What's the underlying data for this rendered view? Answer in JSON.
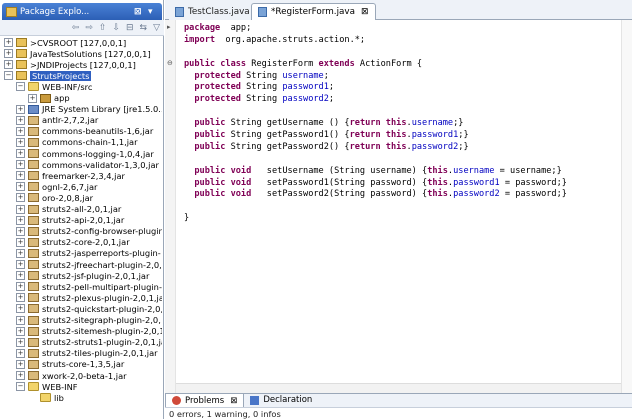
{
  "explorer": {
    "title": "Package Explo...",
    "close": "⊠",
    "menu": "▾",
    "toolbar": [
      "⇦",
      "⇨",
      "⇧",
      "⇩",
      "⊟",
      "⇆",
      "▽"
    ],
    "items": [
      {
        "label": ">CVSROOT   [127,0,0,1]",
        "icon": "project-icon",
        "expander": "+",
        "indent": 0
      },
      {
        "label": "JavaTestSolutions   [127,0,0,1]",
        "icon": "project-icon",
        "expander": "+",
        "indent": 0
      },
      {
        "label": ">JNDIProjects   [127,0,0,1]",
        "icon": "project-icon",
        "expander": "+",
        "indent": 0
      },
      {
        "label": "StrutsProjects",
        "icon": "project-icon",
        "expander": "−",
        "indent": 0,
        "selected": true
      },
      {
        "label": "WEB-INF/src",
        "icon": "source-folder-icon",
        "expander": "−",
        "indent": 1
      },
      {
        "label": "app",
        "icon": "package-icon",
        "expander": "+",
        "indent": 2
      },
      {
        "label": "JRE System Library [jre1.5.0...",
        "icon": "library-icon",
        "expander": "+",
        "indent": 1
      },
      {
        "label": "antlr-2,7,2,jar",
        "icon": "jar-icon",
        "expander": "+",
        "indent": 1
      },
      {
        "label": "commons-beanutils-1,6,jar",
        "icon": "jar-icon",
        "expander": "+",
        "indent": 1
      },
      {
        "label": "commons-chain-1,1,jar",
        "icon": "jar-icon",
        "expander": "+",
        "indent": 1
      },
      {
        "label": "commons-logging-1,0,4,jar",
        "icon": "jar-icon",
        "expander": "+",
        "indent": 1
      },
      {
        "label": "commons-validator-1,3,0,jar",
        "icon": "jar-icon",
        "expander": "+",
        "indent": 1
      },
      {
        "label": "freemarker-2,3,4,jar",
        "icon": "jar-icon",
        "expander": "+",
        "indent": 1
      },
      {
        "label": "ognl-2,6,7,jar",
        "icon": "jar-icon",
        "expander": "+",
        "indent": 1
      },
      {
        "label": "oro-2,0,8,jar",
        "icon": "jar-icon",
        "expander": "+",
        "indent": 1
      },
      {
        "label": "struts2-all-2,0,1,jar",
        "icon": "jar-icon",
        "expander": "+",
        "indent": 1
      },
      {
        "label": "struts2-api-2,0,1,jar",
        "icon": "jar-icon",
        "expander": "+",
        "indent": 1
      },
      {
        "label": "struts2-config-browser-plugin",
        "icon": "jar-icon",
        "expander": "+",
        "indent": 1
      },
      {
        "label": "struts2-core-2,0,1,jar",
        "icon": "jar-icon",
        "expander": "+",
        "indent": 1
      },
      {
        "label": "struts2-jasperreports-plugin-",
        "icon": "jar-icon",
        "expander": "+",
        "indent": 1
      },
      {
        "label": "struts2-jfreechart-plugin-2,0,",
        "icon": "jar-icon",
        "expander": "+",
        "indent": 1
      },
      {
        "label": "struts2-jsf-plugin-2,0,1,jar",
        "icon": "jar-icon",
        "expander": "+",
        "indent": 1
      },
      {
        "label": "struts2-pell-multipart-plugin-",
        "icon": "jar-icon",
        "expander": "+",
        "indent": 1
      },
      {
        "label": "struts2-plexus-plugin-2,0,1,ja",
        "icon": "jar-icon",
        "expander": "+",
        "indent": 1
      },
      {
        "label": "struts2-quickstart-plugin-2,0,",
        "icon": "jar-icon",
        "expander": "+",
        "indent": 1
      },
      {
        "label": "struts2-sitegraph-plugin-2,0,",
        "icon": "jar-icon",
        "expander": "+",
        "indent": 1
      },
      {
        "label": "struts2-sitemesh-plugin-2,0,1",
        "icon": "jar-icon",
        "expander": "+",
        "indent": 1
      },
      {
        "label": "struts2-struts1-plugin-2,0,1,ja",
        "icon": "jar-icon",
        "expander": "+",
        "indent": 1
      },
      {
        "label": "struts2-tiles-plugin-2,0,1,jar",
        "icon": "jar-icon",
        "expander": "+",
        "indent": 1
      },
      {
        "label": "struts-core-1,3,5,jar",
        "icon": "jar-icon",
        "expander": "+",
        "indent": 1
      },
      {
        "label": "xwork-2,0-beta-1,jar",
        "icon": "jar-icon",
        "expander": "+",
        "indent": 1
      },
      {
        "label": "WEB-INF",
        "icon": "folder-icon",
        "expander": "−",
        "indent": 1
      },
      {
        "label": "lib",
        "icon": "folder-icon",
        "expander": "",
        "indent": 2
      }
    ]
  },
  "editor": {
    "tabs": [
      {
        "label": "TestClass.java",
        "active": false
      },
      {
        "label": "*RegisterForm.java",
        "active": true,
        "close": "⊠"
      }
    ],
    "code": [
      [
        [
          "kw",
          "package"
        ],
        [
          "",
          "  app;"
        ]
      ],
      [
        [
          "kw",
          "import"
        ],
        [
          "",
          "  org.apache.struts.action.*;"
        ]
      ],
      [
        [
          "",
          ""
        ]
      ],
      [
        [
          "kw",
          "public class"
        ],
        [
          "",
          " RegisterForm "
        ],
        [
          "kw",
          "extends"
        ],
        [
          "",
          " ActionForm {"
        ]
      ],
      [
        [
          "",
          "  "
        ],
        [
          "kw",
          "protected"
        ],
        [
          "",
          " String "
        ],
        [
          "fld",
          "username"
        ],
        [
          "",
          ";"
        ]
      ],
      [
        [
          "",
          "  "
        ],
        [
          "kw",
          "protected"
        ],
        [
          "",
          " String "
        ],
        [
          "fld",
          "password1"
        ],
        [
          "",
          ";"
        ]
      ],
      [
        [
          "",
          "  "
        ],
        [
          "kw",
          "protected"
        ],
        [
          "",
          " String "
        ],
        [
          "fld",
          "password2"
        ],
        [
          "",
          ";"
        ]
      ],
      [
        [
          "",
          ""
        ]
      ],
      [
        [
          "",
          "  "
        ],
        [
          "kw",
          "public"
        ],
        [
          "",
          " String getUsername () {"
        ],
        [
          "kw",
          "return this"
        ],
        [
          "",
          "."
        ],
        [
          "fld",
          "username"
        ],
        [
          "",
          ";}"
        ]
      ],
      [
        [
          "",
          "  "
        ],
        [
          "kw",
          "public"
        ],
        [
          "",
          " String getPassword1() {"
        ],
        [
          "kw",
          "return this"
        ],
        [
          "",
          "."
        ],
        [
          "fld",
          "password1"
        ],
        [
          "",
          ";}"
        ]
      ],
      [
        [
          "",
          "  "
        ],
        [
          "kw",
          "public"
        ],
        [
          "",
          " String getPassword2() {"
        ],
        [
          "kw",
          "return this"
        ],
        [
          "",
          "."
        ],
        [
          "fld",
          "password2"
        ],
        [
          "",
          ";}"
        ]
      ],
      [
        [
          "",
          ""
        ]
      ],
      [
        [
          "",
          "  "
        ],
        [
          "kw",
          "public void"
        ],
        [
          "",
          "   setUsername (String username) {"
        ],
        [
          "kw",
          "this"
        ],
        [
          "",
          "."
        ],
        [
          "fld",
          "username"
        ],
        [
          "",
          " = username;}"
        ]
      ],
      [
        [
          "",
          "  "
        ],
        [
          "kw",
          "public void"
        ],
        [
          "",
          "   setPassword1(String password) {"
        ],
        [
          "kw",
          "this"
        ],
        [
          "",
          "."
        ],
        [
          "fld",
          "password1"
        ],
        [
          "",
          " = password;}"
        ]
      ],
      [
        [
          "",
          "  "
        ],
        [
          "kw",
          "public void"
        ],
        [
          "",
          "   setPassword2(String password) {"
        ],
        [
          "kw",
          "this"
        ],
        [
          "",
          "."
        ],
        [
          "fld",
          "password2"
        ],
        [
          "",
          " = password;}"
        ]
      ],
      [
        [
          "",
          ""
        ]
      ],
      [
        [
          "",
          "}"
        ]
      ]
    ]
  },
  "bottom": {
    "tabs": [
      {
        "label": "Problems",
        "active": true,
        "close": "⊠"
      },
      {
        "label": "Declaration",
        "active": false
      }
    ],
    "status": "0 errors, 1 warning, 0 infos"
  }
}
